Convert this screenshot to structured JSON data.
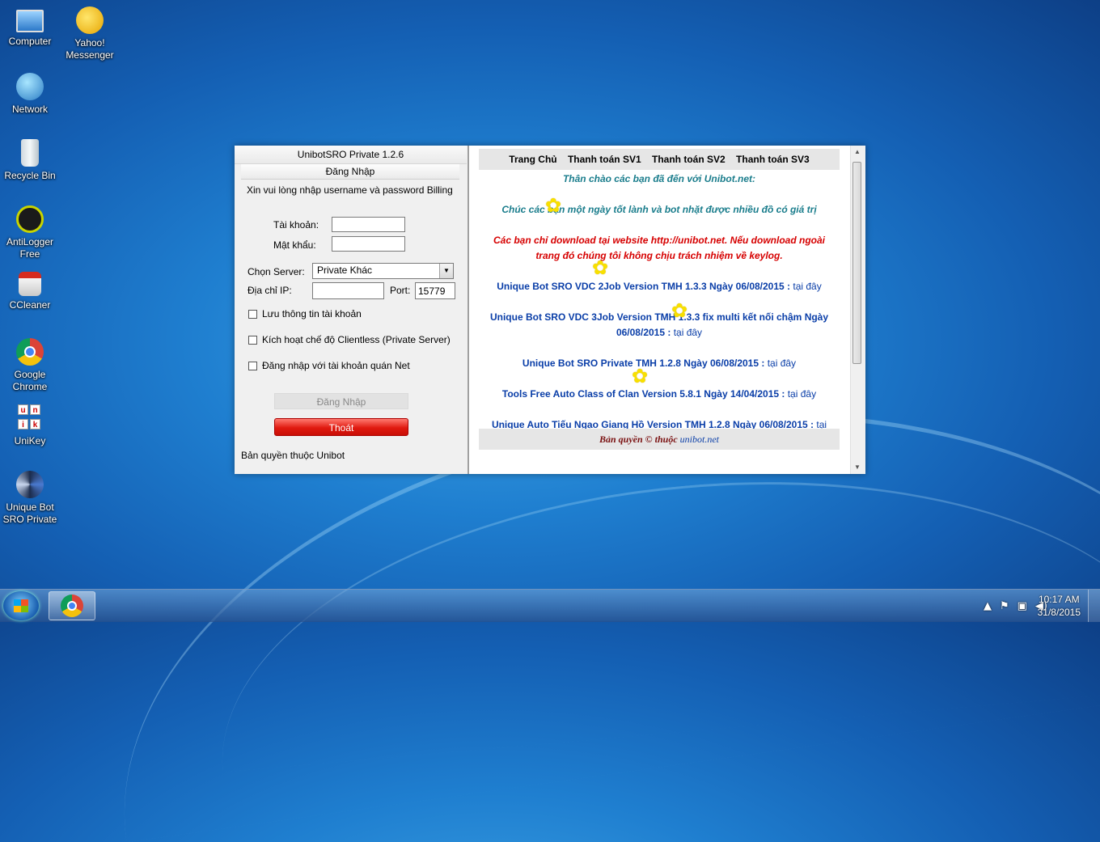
{
  "desktop": {
    "icons": [
      {
        "label": "Computer"
      },
      {
        "label": "Yahoo! Messenger"
      },
      {
        "label": "Network"
      },
      {
        "label": "Recycle Bin"
      },
      {
        "label": "AntiLogger Free"
      },
      {
        "label": "CCleaner"
      },
      {
        "label": "Google Chrome"
      },
      {
        "label": "UniKey"
      },
      {
        "label": "Unique Bot SRO Private"
      }
    ]
  },
  "app": {
    "title": "UnibotSRO Private 1.2.6",
    "tab": "Đăng Nhập",
    "intro": "Xin vui lòng nhập username và password Billing",
    "account_label": "Tài khoản:",
    "account_value": "",
    "password_label": "Mật khẩu:",
    "password_value": "",
    "server_label": "Chọn Server:",
    "server_value": "Private Khác",
    "ip_label": "Địa chỉ IP:",
    "ip_value": "",
    "port_label": "Port:",
    "port_value": "15779",
    "checkboxes": [
      {
        "label": "Lưu thông tin tài khoản",
        "checked": false
      },
      {
        "label": "Kích hoạt chế độ Clientless (Private Server)",
        "checked": false
      },
      {
        "label": "Đăng nhập với tài khoản quán Net",
        "checked": false
      }
    ],
    "login_button": "Đăng Nhập",
    "exit_button": "Thoát",
    "copyright": "Bản quyền thuộc Unibot"
  },
  "web": {
    "nav": [
      "Trang Chủ",
      "Thanh toán SV1",
      "Thanh toán SV2",
      "Thanh toán SV3"
    ],
    "welcome": "Thân chào các bạn đã đến với Unibot.net:",
    "wish": "Chúc các bạn một ngày tốt lành và bot nhặt được nhiều đồ có giá trị",
    "warning1": "Các bạn chỉ download tại website http://unibot.net. Nếu download ngoài",
    "warning2": "trang đó chúng tôi không chịu trách nhiệm về keylog.",
    "items": [
      {
        "text": "Unique Bot SRO VDC 2Job Version TMH 1.3.3 Ngày 06/08/2015 : ",
        "link": "tại đây"
      },
      {
        "text": "Unique Bot SRO VDC 3Job Version TMH 1.3.3 fix multi kết nối chậm Ngày",
        "text2": "06/08/2015 : ",
        "link": "tại đây"
      },
      {
        "text": "Unique Bot SRO Private TMH 1.2.8 Ngày 06/08/2015 : ",
        "link": "tại đây"
      },
      {
        "text": "Tools Free Auto Class of Clan Version 5.8.1 Ngày 14/04/2015 : ",
        "link": "tại đây"
      },
      {
        "text": "Unique Auto Tiếu Ngạo Giang Hồ Version TMH 1.2.8 Ngày 06/08/2015 : ",
        "link": "tại"
      }
    ],
    "footer_text": "Bản quyền © thuộc ",
    "footer_link": "unibot.net"
  },
  "taskbar": {
    "time": "10:17 AM",
    "date": "31/8/2015"
  }
}
